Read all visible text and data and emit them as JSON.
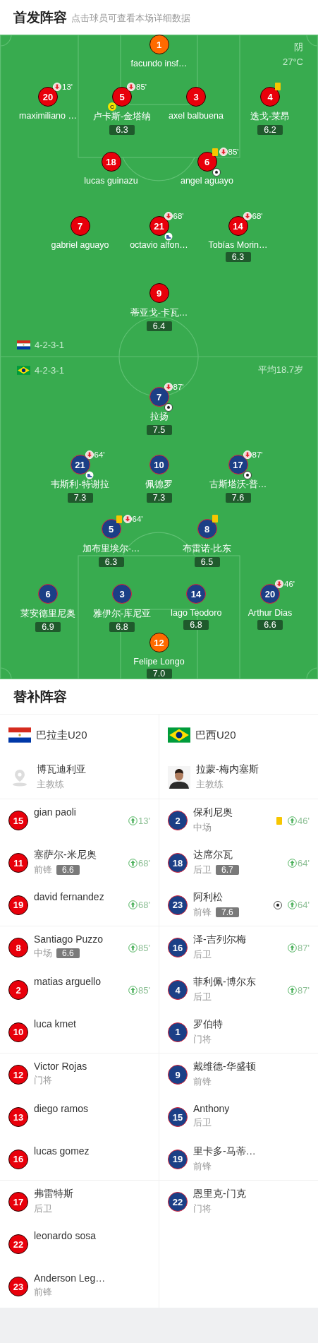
{
  "lineup_header": {
    "title": "首发阵容",
    "subtitle": "点击球员可查看本场详细数据"
  },
  "pitch": {
    "weather": {
      "condition": "阴",
      "temperature": "27°C"
    },
    "teams": [
      {
        "formation": "4-2-3-1",
        "lines": [
          [
            {
              "number": "1",
              "name": "facundo insf…",
              "kind": "goalkeeper"
            }
          ],
          [
            {
              "number": "20",
              "name": "maximiliano …",
              "kind": "outfield",
              "events": [
                {
                  "kind": "sub_out",
                  "minute": "13'"
                }
              ]
            },
            {
              "number": "5",
              "name": "卢卡斯-金塔纳",
              "kind": "outfield",
              "rating": "6.3",
              "events": [
                {
                  "kind": "sub_out",
                  "minute": "85'"
                },
                {
                  "kind": "captain",
                  "label": "C"
                }
              ]
            },
            {
              "number": "3",
              "name": "axel balbuena",
              "kind": "outfield"
            },
            {
              "number": "4",
              "name": "迭戈-莱昂",
              "kind": "outfield",
              "rating": "6.2",
              "events": [
                {
                  "kind": "yellow_card"
                }
              ]
            }
          ],
          [
            {
              "number": "18",
              "name": "lucas guinazu",
              "kind": "outfield"
            },
            {
              "number": "6",
              "name": "angel aguayo",
              "kind": "outfield",
              "events": [
                {
                  "kind": "yellow_card"
                },
                {
                  "kind": "sub_out",
                  "minute": "85'"
                },
                {
                  "kind": "goal"
                }
              ]
            }
          ],
          [
            {
              "number": "7",
              "name": "gabriel aguayo",
              "kind": "outfield"
            },
            {
              "number": "21",
              "name": "octavio alfon…",
              "kind": "outfield",
              "events": [
                {
                  "kind": "sub_out",
                  "minute": "68'"
                },
                {
                  "kind": "assist"
                }
              ]
            },
            {
              "number": "14",
              "name": "Tobías Morin…",
              "kind": "outfield",
              "rating": "6.3",
              "events": [
                {
                  "kind": "sub_out",
                  "minute": "68'"
                }
              ]
            }
          ],
          [
            {
              "number": "9",
              "name": "蒂亚戈-卡瓦…",
              "kind": "outfield",
              "rating": "6.4"
            }
          ]
        ]
      },
      {
        "formation": "4-2-3-1",
        "average_age": "平均18.7岁",
        "lines": [
          [
            {
              "number": "7",
              "name": "拉扬",
              "kind": "outfield",
              "rating": "7.5",
              "events": [
                {
                  "kind": "sub_out",
                  "minute": "87'"
                },
                {
                  "kind": "goal"
                }
              ]
            }
          ],
          [
            {
              "number": "21",
              "name": "韦斯利-特谢拉",
              "kind": "outfield",
              "rating": "7.3",
              "events": [
                {
                  "kind": "sub_out",
                  "minute": "64'"
                },
                {
                  "kind": "assist"
                }
              ]
            },
            {
              "number": "10",
              "name": "佩德罗",
              "kind": "outfield",
              "rating": "7.3"
            },
            {
              "number": "17",
              "name": "古斯塔沃-普…",
              "kind": "outfield",
              "rating": "7.6",
              "events": [
                {
                  "kind": "sub_out",
                  "minute": "87'"
                },
                {
                  "kind": "goal"
                }
              ]
            }
          ],
          [
            {
              "number": "5",
              "name": "加布里埃尔-…",
              "kind": "outfield",
              "rating": "6.3",
              "events": [
                {
                  "kind": "yellow_card"
                },
                {
                  "kind": "sub_out",
                  "minute": "64'"
                }
              ]
            },
            {
              "number": "8",
              "name": "布雷诺-比东",
              "kind": "outfield",
              "rating": "6.5",
              "events": [
                {
                  "kind": "yellow_card"
                }
              ]
            }
          ],
          [
            {
              "number": "6",
              "name": "莱安德里尼奥",
              "kind": "outfield",
              "rating": "6.9"
            },
            {
              "number": "3",
              "name": "雅伊尔-库尼亚",
              "kind": "outfield",
              "rating": "6.8"
            },
            {
              "number": "14",
              "name": "Iago Teodoro",
              "kind": "outfield",
              "rating": "6.8"
            },
            {
              "number": "20",
              "name": "Arthur Dias",
              "kind": "outfield",
              "rating": "6.6",
              "events": [
                {
                  "kind": "sub_out",
                  "minute": "46'"
                }
              ]
            }
          ],
          [
            {
              "number": "12",
              "name": "Felipe Longo",
              "kind": "goalkeeper",
              "rating": "7.0"
            }
          ]
        ]
      }
    ]
  },
  "substitutes": {
    "title": "替补阵容",
    "teams": [
      {
        "name": "巴拉圭U20",
        "coach": {
          "name": "博瓦迪利亚",
          "role": "主教练"
        },
        "players": [
          {
            "number": "15",
            "name": "gian paoli",
            "events": [
              {
                "kind": "sub_in",
                "minute": "13'"
              }
            ]
          },
          {
            "number": "11",
            "name": "塞萨尔-米尼奥",
            "position": "前锋",
            "rating": "6.6",
            "events": [
              {
                "kind": "sub_in",
                "minute": "68'"
              }
            ]
          },
          {
            "number": "19",
            "name": "david fernandez",
            "events": [
              {
                "kind": "sub_in",
                "minute": "68'"
              }
            ]
          },
          {
            "number": "8",
            "name": "Santiago Puzzo",
            "position": "中场",
            "rating": "6.6",
            "events": [
              {
                "kind": "sub_in",
                "minute": "85'"
              }
            ]
          },
          {
            "number": "2",
            "name": "matias arguello",
            "events": [
              {
                "kind": "sub_in",
                "minute": "85'"
              }
            ]
          },
          {
            "number": "10",
            "name": "luca kmet"
          },
          {
            "number": "12",
            "name": "Victor Rojas",
            "position": "门将"
          },
          {
            "number": "13",
            "name": "diego ramos"
          },
          {
            "number": "16",
            "name": "lucas gomez"
          },
          {
            "number": "17",
            "name": "弗雷特斯",
            "position": "后卫"
          },
          {
            "number": "22",
            "name": "leonardo sosa"
          },
          {
            "number": "23",
            "name": "Anderson Leg…",
            "position": "前锋"
          }
        ]
      },
      {
        "name": "巴西U20",
        "coach": {
          "name": "拉蒙-梅内塞斯",
          "role": "主教练"
        },
        "players": [
          {
            "number": "2",
            "name": "保利尼奥",
            "position": "中场",
            "events": [
              {
                "kind": "yellow_card"
              },
              {
                "kind": "sub_in",
                "minute": "46'"
              }
            ]
          },
          {
            "number": "18",
            "name": "达席尔瓦",
            "position": "后卫",
            "rating": "6.7",
            "events": [
              {
                "kind": "sub_in",
                "minute": "64'"
              }
            ]
          },
          {
            "number": "23",
            "name": "阿利松",
            "position": "前锋",
            "rating": "7.6",
            "events": [
              {
                "kind": "goal"
              },
              {
                "kind": "sub_in",
                "minute": "64'"
              }
            ]
          },
          {
            "number": "16",
            "name": "泽-吉列尔梅",
            "position": "后卫",
            "events": [
              {
                "kind": "sub_in",
                "minute": "87'"
              }
            ]
          },
          {
            "number": "4",
            "name": "菲利佩-博尔东",
            "position": "后卫",
            "events": [
              {
                "kind": "sub_in",
                "minute": "87'"
              }
            ]
          },
          {
            "number": "1",
            "name": "罗伯特",
            "position": "门将"
          },
          {
            "number": "9",
            "name": "戴维德-华盛顿",
            "position": "前锋"
          },
          {
            "number": "15",
            "name": "Anthony",
            "position": "后卫"
          },
          {
            "number": "19",
            "name": "里卡多-马蒂…",
            "position": "前锋"
          },
          {
            "number": "22",
            "name": "恩里克-门克",
            "position": "门将"
          }
        ]
      }
    ]
  }
}
